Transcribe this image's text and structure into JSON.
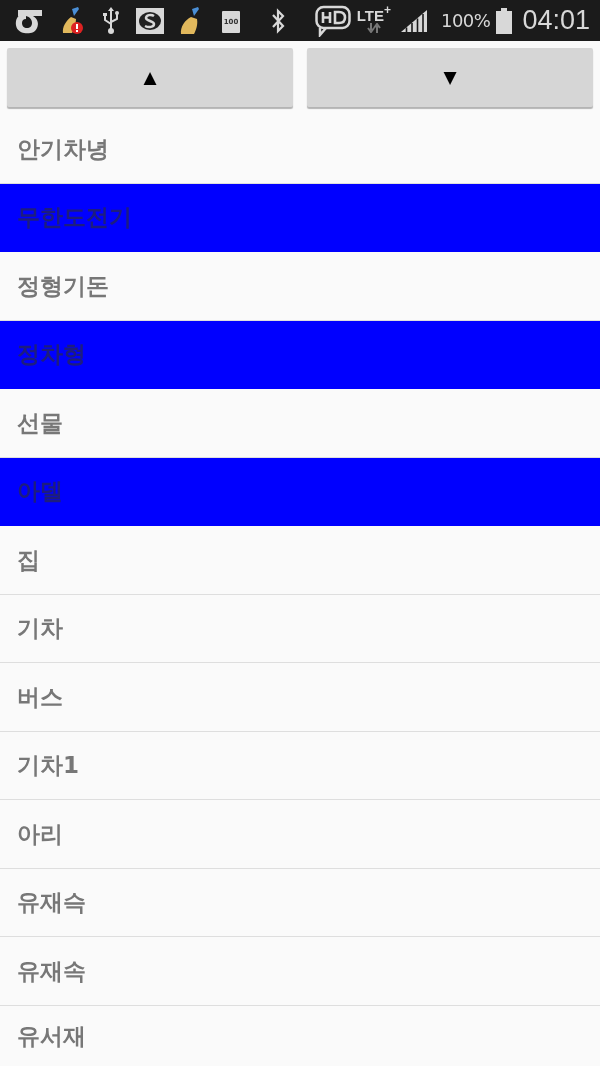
{
  "status_bar": {
    "battery_icon_label": "100",
    "network": "LTE$^{+}$",
    "battery_percent": "100%",
    "time": "04:01"
  },
  "buttons": [
    {
      "label": "▲"
    },
    {
      "label": "▼"
    }
  ],
  "items": [
    {
      "label": "안기차녕",
      "selected": false
    },
    {
      "label": "무한도전기",
      "selected": true
    },
    {
      "label": "정형기돈",
      "selected": false
    },
    {
      "label": "정차형",
      "selected": true
    },
    {
      "label": "선물",
      "selected": false
    },
    {
      "label": "아델",
      "selected": true
    },
    {
      "label": "집",
      "selected": false
    },
    {
      "label": "기차",
      "selected": false
    },
    {
      "label": "버스",
      "selected": false
    },
    {
      "label": "기차1",
      "selected": false
    },
    {
      "label": "아리",
      "selected": false
    },
    {
      "label": "유재슥",
      "selected": false
    },
    {
      "label": "유재속",
      "selected": false
    },
    {
      "label": "유서재",
      "selected": false
    }
  ]
}
